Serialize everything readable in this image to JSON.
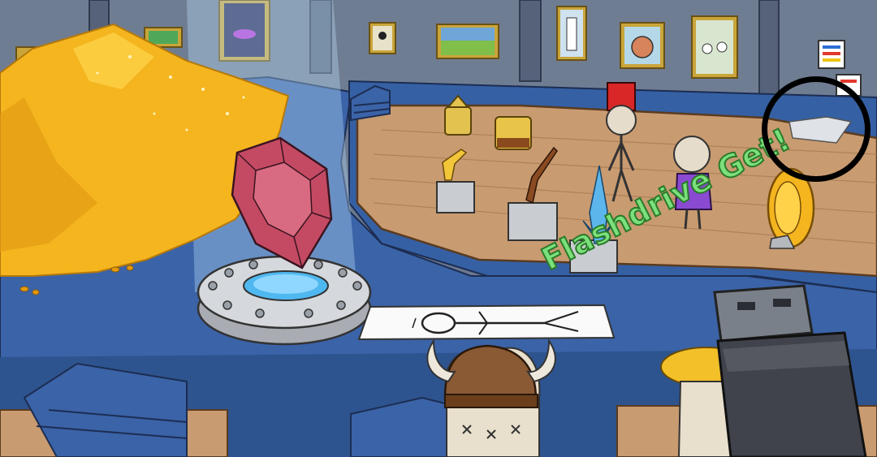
{
  "scene": {
    "banner_text": "Flashdrive Get!",
    "colors": {
      "wall": "#6f7d93",
      "floor_blue": "#3b63a7",
      "stage_wood": "#c79a70",
      "gold": "#f4b51e",
      "gem": "#c44a63",
      "banner_fill": "#7be07b"
    }
  },
  "items": {
    "gold_pile": "gold-pile",
    "ruby_gem": "ruby-gem",
    "teleporter_pad": "teleporter-pad",
    "stickman_drawing": "stickman-drawing",
    "flashdrive": "flashdrive-item",
    "paper_note": "paper-note"
  }
}
